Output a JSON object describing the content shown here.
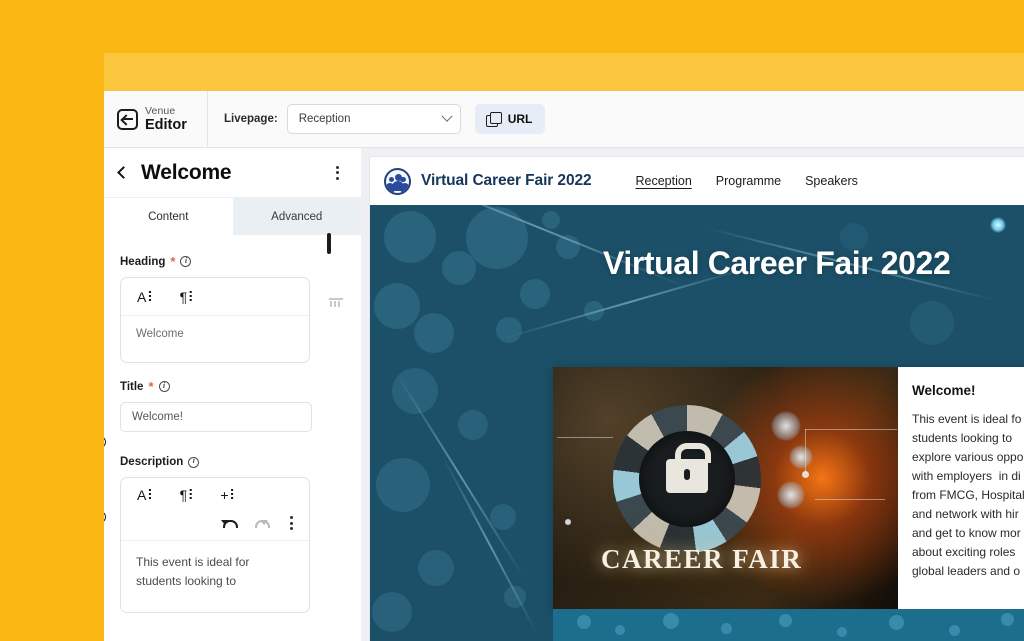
{
  "theme": {
    "page_background": "#FBB713",
    "window_top_strip": "#FBC63E",
    "accent_blue": "#e7edf6",
    "hero_blue": "#1b5068",
    "required_marker": "#e8643c"
  },
  "toolbar": {
    "brand_line1": "Venue",
    "brand_line2": "Editor",
    "brand_logo_icon": "venue-editor-logo-icon",
    "livepage_label": "Livepage:",
    "livepage_selected": "Reception",
    "livepage_options": [
      "Reception"
    ],
    "chevron_icon": "chevron-down-icon",
    "url_label": "URL",
    "url_icon": "copy-icon"
  },
  "sidebar": {
    "back_icon": "chevron-left-icon",
    "title": "Welcome",
    "menu_icon": "kebab-menu-icon",
    "tabs": [
      {
        "label": "Content",
        "active": true
      },
      {
        "label": "Advanced",
        "active": false
      }
    ],
    "rail_icons": [
      {
        "name": "monitor-icon"
      },
      {
        "name": "mobile-icon"
      },
      {
        "name": "eye-icon"
      },
      {
        "name": "eye-icon"
      }
    ],
    "fields": {
      "heading": {
        "label": "Heading",
        "required_mark": "*",
        "info_icon": "info-icon",
        "toolbar_items": [
          "A⠇",
          "¶⠇"
        ],
        "value": "Welcome"
      },
      "title": {
        "label": "Title",
        "required_mark": "*",
        "info_icon": "info-icon",
        "value": "Welcome!"
      },
      "description": {
        "label": "Description",
        "info_icon": "info-icon",
        "toolbar_items": [
          "A⠇",
          "¶⠇",
          "+⠇"
        ],
        "undo_icon": "undo-icon",
        "redo_icon": "redo-icon",
        "more_icon": "kebab-menu-icon",
        "value": "This event is ideal for\nstudents looking to"
      }
    }
  },
  "preview": {
    "site_logo_icon": "people-group-logo-icon",
    "site_title": "Virtual Career Fair 2022",
    "nav_links": [
      {
        "label": "Reception",
        "active": true
      },
      {
        "label": "Programme",
        "active": false
      },
      {
        "label": "Speakers",
        "active": false
      }
    ],
    "hero_title": "Virtual Career Fair 2022",
    "card": {
      "image_caption": "CAREER FAIR",
      "heading": "Welcome!",
      "body": "This event is ideal fo\nstudents looking to\nexplore various oppo\nwith employers  in di\nfrom FMCG, Hospital\nand network with hir\nand get to know mor\nabout exciting roles \nglobal leaders and o"
    }
  }
}
